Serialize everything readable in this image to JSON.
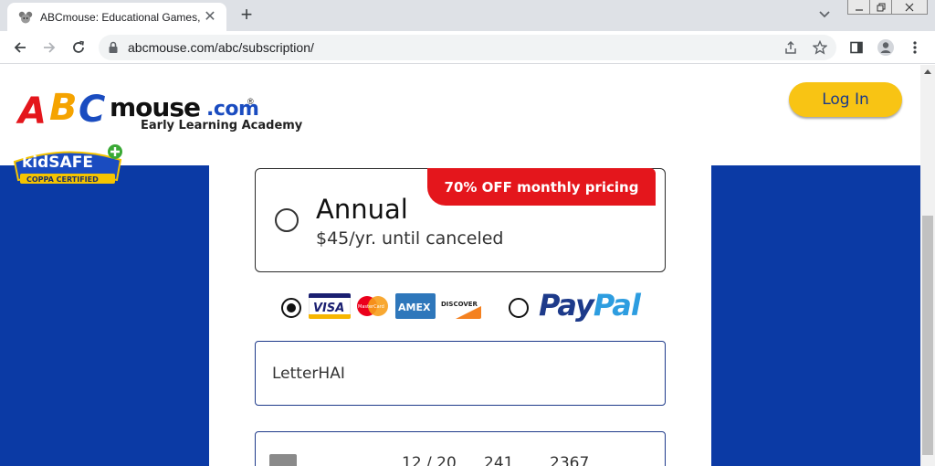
{
  "browser": {
    "tab_title": "ABCmouse: Educational Games, B",
    "tab_close": "✕",
    "new_tab": "+",
    "url": "abcmouse.com/abc/subscription/"
  },
  "header": {
    "logo_a": "A",
    "logo_b": "B",
    "logo_c": "C",
    "logo_mouse": "mouse",
    "logo_com": ".com",
    "logo_reg": "®",
    "logo_tagline": "Early Learning Academy",
    "login_label": "Log In",
    "kidsafe_text": "kidSAFE",
    "kidsafe_sub": "COPPA CERTIFIED"
  },
  "plan": {
    "promo": "70% OFF monthly pricing",
    "name": "Annual",
    "price": "$45/yr. until canceled"
  },
  "payment": {
    "card_logos": [
      "VISA",
      "MasterCard",
      "AMEX",
      "DISCOVER"
    ],
    "paypal_pay": "Pay",
    "paypal_pal": "Pal",
    "selected": "card"
  },
  "form": {
    "name_value": "LetterHAI",
    "card_month_year": "12 / 20",
    "card_num_a": "241",
    "card_num_b": "2367"
  },
  "colors": {
    "brand_blue": "#0b3aa5",
    "login_yellow": "#f8c414",
    "promo_red": "#e4161c",
    "paypal_dark": "#1d3a8a",
    "paypal_light": "#2d9de0"
  }
}
